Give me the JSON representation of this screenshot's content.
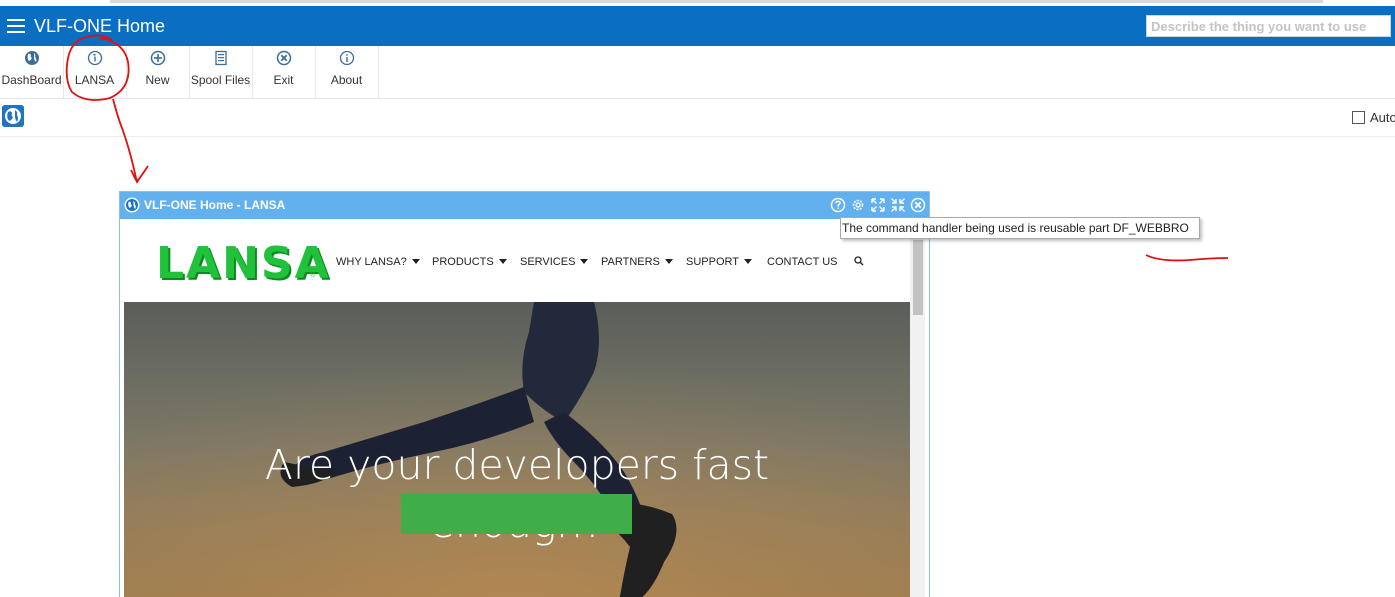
{
  "app": {
    "title": "VLF-ONE Home"
  },
  "search": {
    "placeholder": "Describe the thing you want to use"
  },
  "toolbar": {
    "items": [
      {
        "label": "DashBoard",
        "icon": "globe-icon"
      },
      {
        "label": "LANSA",
        "icon": "info-circle-icon"
      },
      {
        "label": "New",
        "icon": "plus-circle-icon"
      },
      {
        "label": "Spool Files",
        "icon": "document-icon"
      },
      {
        "label": "Exit",
        "icon": "close-circle-icon"
      },
      {
        "label": "About",
        "icon": "info-icon"
      }
    ]
  },
  "options": {
    "auto_label": "Auto",
    "auto_checked": false
  },
  "panel": {
    "title": "VLF-ONE Home - LANSA",
    "header_icons": [
      "help-icon",
      "settings-icon",
      "expand-icon",
      "collapse-icon",
      "close-icon"
    ]
  },
  "tooltip": {
    "text": "The command handler being used is reusable part DF_WEBBRO"
  },
  "website": {
    "logo": "LANSA",
    "nav": [
      {
        "label": "WHY LANSA?",
        "dropdown": true
      },
      {
        "label": "PRODUCTS",
        "dropdown": true
      },
      {
        "label": "SERVICES",
        "dropdown": true
      },
      {
        "label": "PARTNERS",
        "dropdown": true
      },
      {
        "label": "SUPPORT",
        "dropdown": true
      },
      {
        "label": "CONTACT US",
        "dropdown": false
      }
    ],
    "hero_line1": "Are your developers fast",
    "hero_line2": "enough?"
  },
  "colors": {
    "titlebar": "#0a6fc2",
    "panel_header": "#63b0ee",
    "logo_green": "#1fc23a",
    "cta_green": "#3fae48",
    "annotation_red": "#e01010"
  }
}
